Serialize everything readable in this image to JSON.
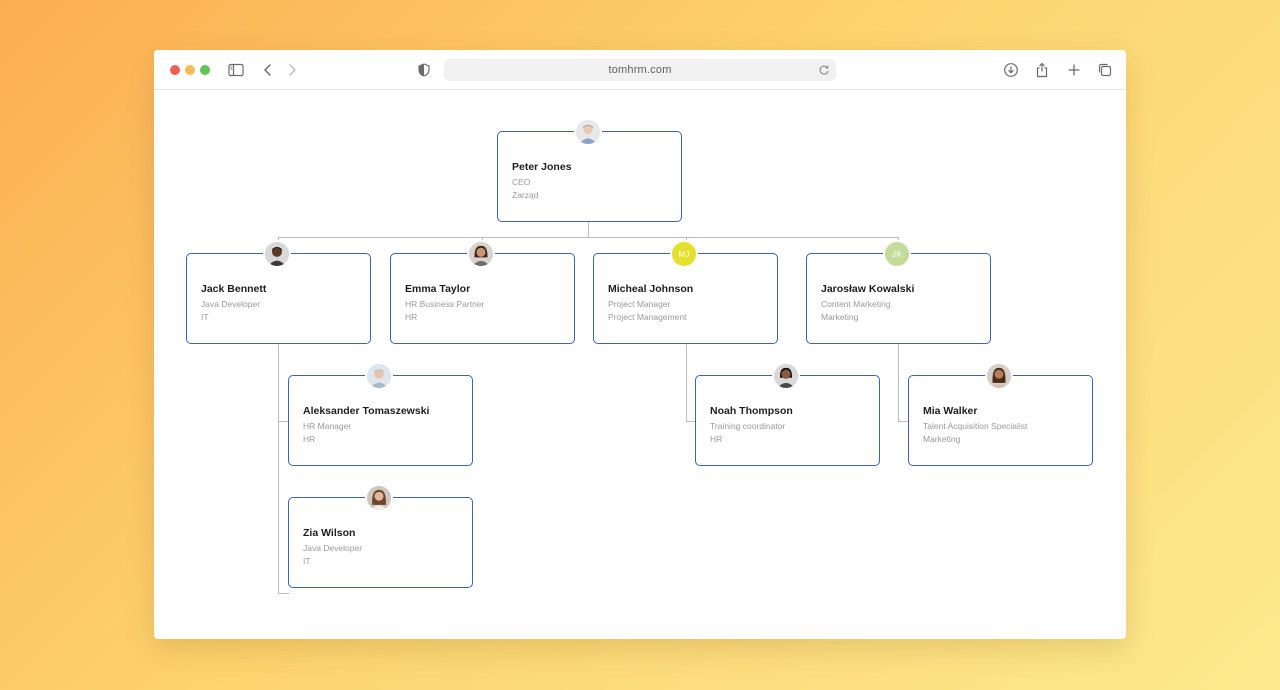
{
  "browser": {
    "url": "tomhrm.com"
  },
  "people": [
    {
      "id": "peter",
      "name": "Peter Jones",
      "role": "CEO",
      "dept": "Zarząd",
      "avatar": {
        "kind": "photo",
        "skin": "#e9c9b0",
        "hair": "#8a8a8a",
        "bg": "#e8e8ea"
      }
    },
    {
      "id": "jack",
      "name": "Jack Bennett",
      "role": "Java Developer",
      "dept": "IT",
      "avatar": {
        "kind": "photo",
        "skin": "#5b3a2a",
        "hair": "#1c1410",
        "bg": "#d8d8d8"
      }
    },
    {
      "id": "emma",
      "name": "Emma Taylor",
      "role": "HR Business Partner",
      "dept": "HR",
      "avatar": {
        "kind": "photo",
        "skin": "#c99577",
        "hair": "#3a2518",
        "bg": "#d7d2cc"
      }
    },
    {
      "id": "micheal",
      "name": "Micheal Johnson",
      "role": "Project Manager",
      "dept": "Project Management",
      "avatar": {
        "kind": "initials",
        "initials": "MJ",
        "bg": "#e4e12c"
      }
    },
    {
      "id": "jaroslaw",
      "name": "Jarosław  Kowalski",
      "role": "Content Marketing",
      "dept": "Marketing",
      "avatar": {
        "kind": "initials",
        "initials": "JK",
        "bg": "#c4dc9a"
      }
    },
    {
      "id": "aleksander",
      "name": "Aleksander  Tomaszewski",
      "role": "HR Manager",
      "dept": "HR",
      "avatar": {
        "kind": "photo",
        "skin": "#e6c4ae",
        "hair": "#b9b9b9",
        "bg": "#dfe6ee"
      }
    },
    {
      "id": "zia",
      "name": "Zia Wilson",
      "role": "Java Developer",
      "dept": "IT",
      "avatar": {
        "kind": "photo",
        "skin": "#e2b699",
        "hair": "#6b4630",
        "bg": "#cfc7be"
      }
    },
    {
      "id": "noah",
      "name": "Noah Thompson",
      "role": "Training coordinator",
      "dept": "HR",
      "avatar": {
        "kind": "photo",
        "skin": "#8a5a3e",
        "hair": "#1c1410",
        "bg": "#d9d9d9"
      }
    },
    {
      "id": "mia",
      "name": "Mia Walker",
      "role": "Talent Acquisition Specialist",
      "dept": "Marketing",
      "avatar": {
        "kind": "photo",
        "skin": "#b47e5c",
        "hair": "#4a2a18",
        "bg": "#d6cfc9"
      }
    }
  ],
  "colors": {
    "card_border": "#3f62b8",
    "connector": "#bdbdbd"
  }
}
